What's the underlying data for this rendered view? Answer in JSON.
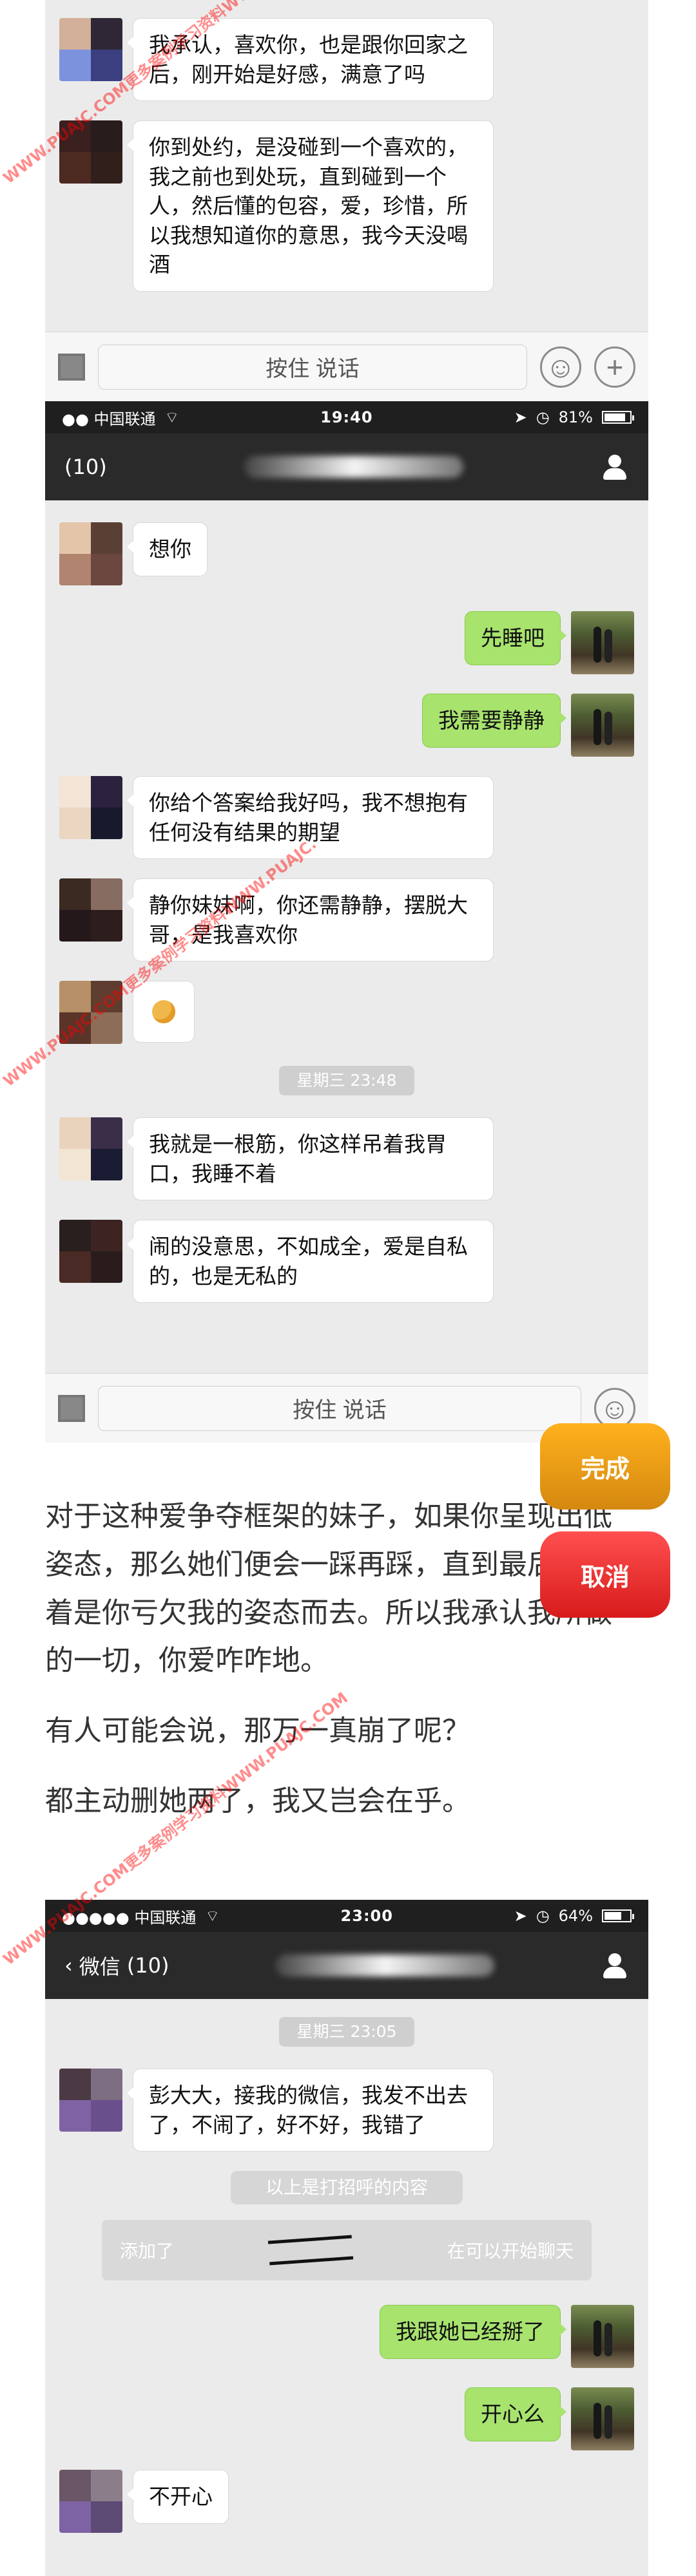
{
  "top_chat": {
    "messages": [
      "我承认，喜欢你，也是跟你回家之后，刚开始是好感，满意了吗",
      "你到处约，是没碰到一个喜欢的，我之前也到处玩，直到碰到一个人，然后懂的包容，爱，珍惜，所以我想知道你的意思，我今天没喝酒"
    ],
    "voice_button": "按住 说话"
  },
  "chat2": {
    "status": {
      "carrier": "●● 中国联通",
      "time": "19:40",
      "battery": "81%",
      "battery_fraction": 0.81
    },
    "nav": {
      "title_count": "(10)"
    },
    "messages": [
      {
        "side": "left",
        "text": "想你"
      },
      {
        "side": "right",
        "text": "先睡吧"
      },
      {
        "side": "right",
        "text": "我需要静静"
      },
      {
        "side": "left",
        "text": "你给个答案给我好吗，我不想抱有任何没有结果的期望"
      },
      {
        "side": "left",
        "text": "静你妹妹啊，你还需静静，摆脱大哥，是我喜欢你"
      },
      {
        "side": "left",
        "text": "😏"
      },
      {
        "side": "time",
        "text": "星期三 23:48"
      },
      {
        "side": "left",
        "text": "我就是一根筋，你这样吊着我胃口，我睡不着"
      },
      {
        "side": "left",
        "text": "闹的没意思，不如成全，爱是自私的，也是无私的"
      }
    ],
    "voice_button": "按住 说话"
  },
  "article": {
    "paragraphs": [
      "对于这种爱争夺框架的妹子，如果你呈现出低姿态，那么她们便会一踩再踩，直到最后，抱着是你亏欠我的姿态而去。所以我承认我所做的一切，你爱咋咋地。",
      "有人可能会说，那万一真崩了呢？",
      "都主动删她两了，我又岂会在乎。"
    ]
  },
  "overlay_buttons": {
    "done": "完成",
    "cancel": "取消"
  },
  "chat3": {
    "status": {
      "carrier": "●●●●● 中国联通",
      "time": "23:00",
      "battery": "64%",
      "battery_fraction": 0.64
    },
    "nav": {
      "back": "微信",
      "title_count": "(10)"
    },
    "messages": [
      {
        "side": "time",
        "text": "星期三 23:05"
      },
      {
        "side": "left",
        "text": "彭大大，接我的微信，我发不出去了，不闹了，好不好，我错了"
      },
      {
        "side": "note",
        "text": "以上是打招呼的内容"
      },
      {
        "side": "blurred",
        "left": "添加了",
        "right": "在可以开始聊天"
      },
      {
        "side": "right",
        "text": "我跟她已经掰了"
      },
      {
        "side": "right",
        "text": "开心么"
      },
      {
        "side": "left",
        "text": "不开心"
      }
    ]
  },
  "watermark": [
    "WWW.PUAJC.COM更多案例学习资料WWW.PUAJC.",
    "WWW.PUAJC.COM更多案例学习资料WWW.PUAJC.",
    "WWW.PUAJC.COM更多案例学习资料WWW.PUAJC.COM"
  ]
}
